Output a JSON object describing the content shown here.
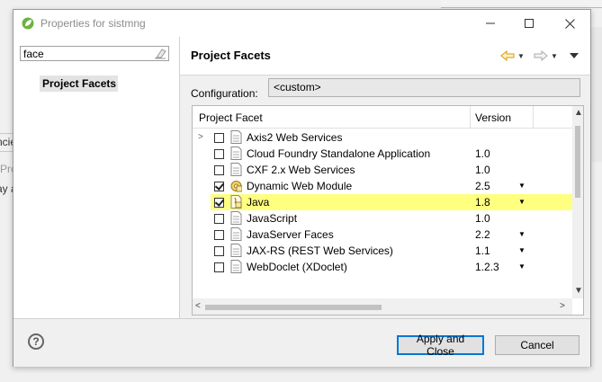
{
  "background": {
    "fragments": [
      "ncie",
      "Pro",
      "ay a"
    ]
  },
  "window": {
    "title": "Properties for sistmng",
    "minimize_label": "—",
    "maximize_label": "☐",
    "close_label": "✕"
  },
  "sidebar": {
    "filter_value": "face",
    "items": [
      {
        "label": "Project Facets",
        "selected": true
      }
    ]
  },
  "main": {
    "title": "Project Facets",
    "configuration_label": "Configuration:",
    "configuration_value": "<custom>",
    "columns": [
      "Project Facet",
      "Version"
    ],
    "facets": [
      {
        "name": "Axis2 Web Services",
        "version": "",
        "checked": false,
        "expandable": true,
        "dropdown": false,
        "icon": "page-icon"
      },
      {
        "name": "Cloud Foundry Standalone Application",
        "version": "1.0",
        "checked": false,
        "expandable": false,
        "dropdown": false,
        "icon": "page-icon"
      },
      {
        "name": "CXF 2.x Web Services",
        "version": "1.0",
        "checked": false,
        "expandable": false,
        "dropdown": false,
        "icon": "page-icon"
      },
      {
        "name": "Dynamic Web Module",
        "version": "2.5",
        "checked": true,
        "expandable": false,
        "dropdown": true,
        "icon": "locked-module-icon"
      },
      {
        "name": "Java",
        "version": "1.8",
        "checked": true,
        "expandable": false,
        "dropdown": true,
        "icon": "locked-java-icon",
        "highlighted": true
      },
      {
        "name": "JavaScript",
        "version": "1.0",
        "checked": false,
        "expandable": false,
        "dropdown": false,
        "icon": "page-icon"
      },
      {
        "name": "JavaServer Faces",
        "version": "2.2",
        "checked": false,
        "expandable": false,
        "dropdown": true,
        "icon": "page-icon"
      },
      {
        "name": "JAX-RS (REST Web Services)",
        "version": "1.1",
        "checked": false,
        "expandable": false,
        "dropdown": true,
        "icon": "page-icon"
      },
      {
        "name": "WebDoclet (XDoclet)",
        "version": "1.2.3",
        "checked": false,
        "expandable": false,
        "dropdown": true,
        "icon": "page-icon"
      }
    ]
  },
  "buttons": {
    "help": "?",
    "apply_close": "Apply and Close",
    "cancel": "Cancel"
  },
  "colors": {
    "highlight": "#ffff80",
    "default_button_border": "#0078d7",
    "back_arrow": "#e6a817"
  }
}
